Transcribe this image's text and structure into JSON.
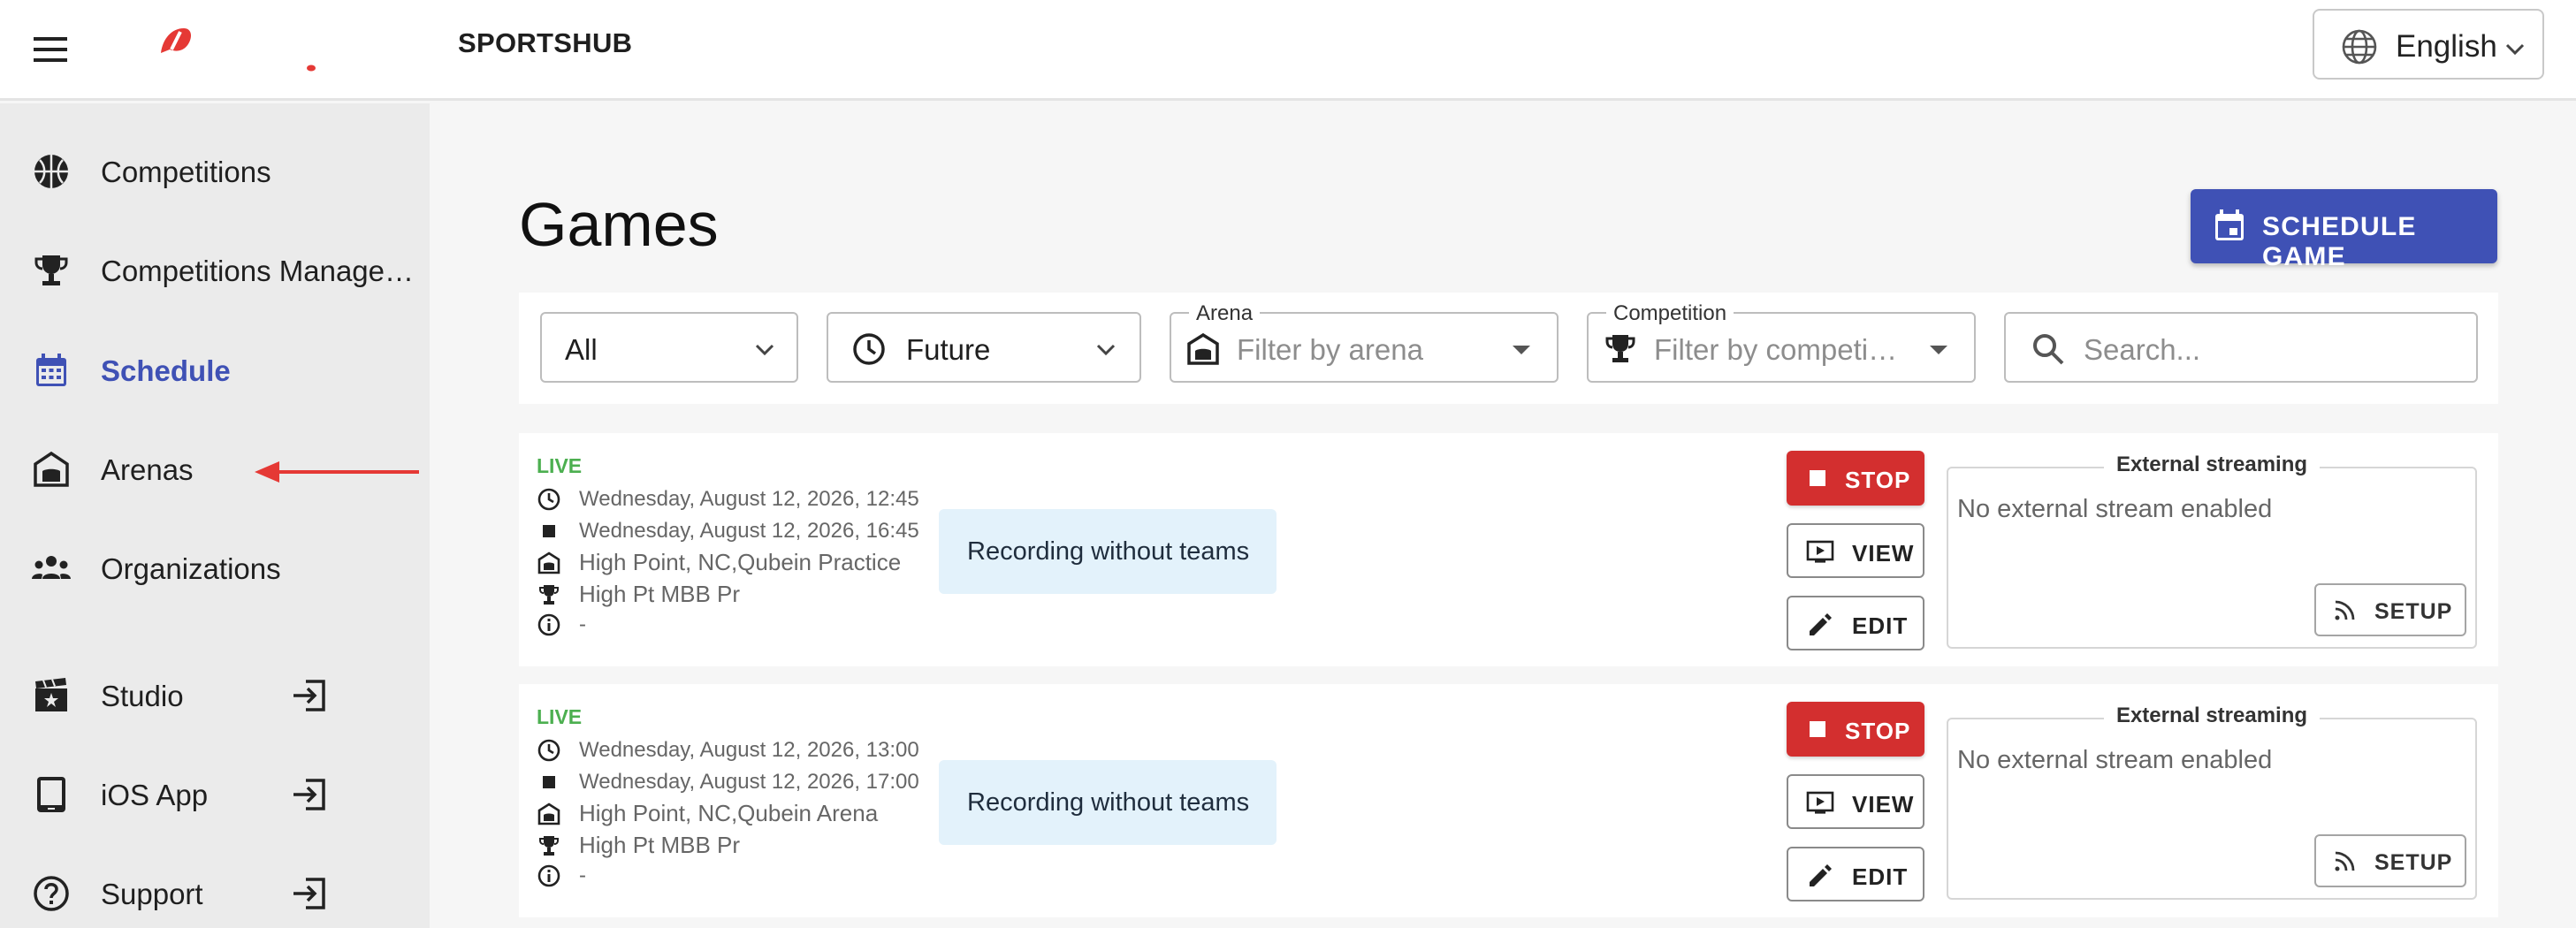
{
  "header": {
    "app_title": "SPORTSHUB",
    "language": "English"
  },
  "sidebar": {
    "items": [
      {
        "label": "Competitions",
        "icon": "basketball-icon"
      },
      {
        "label": "Competitions Management",
        "icon": "trophy-icon"
      },
      {
        "label": "Schedule",
        "icon": "calendar-icon",
        "active": true
      },
      {
        "label": "Arenas",
        "icon": "arena-icon"
      },
      {
        "label": "Organizations",
        "icon": "groups-icon"
      },
      {
        "label": "Studio",
        "icon": "studio-icon",
        "external": true
      },
      {
        "label": "iOS App",
        "icon": "tablet-icon",
        "external": true
      },
      {
        "label": "Support",
        "icon": "help-icon",
        "external": true
      }
    ]
  },
  "main": {
    "title": "Games",
    "schedule_button": "SCHEDULE GAME",
    "filters": {
      "type_value": "All",
      "time_value": "Future",
      "arena_label": "Arena",
      "arena_placeholder": "Filter by arena",
      "competition_label": "Competition",
      "competition_placeholder": "Filter by competition",
      "search_placeholder": "Search..."
    },
    "games": [
      {
        "status": "LIVE",
        "start": "Wednesday, August 12, 2026, 12:45",
        "end": "Wednesday, August 12, 2026, 16:45",
        "arena": "High Point, NC,Qubein Practice",
        "competition": "High Pt MBB Pr",
        "info": "-",
        "recording": "Recording without teams",
        "stop": "STOP",
        "view": "VIEW",
        "edit": "EDIT",
        "streaming_title": "External streaming",
        "streaming_empty": "No external stream enabled",
        "setup": "SETUP"
      },
      {
        "status": "LIVE",
        "start": "Wednesday, August 12, 2026, 13:00",
        "end": "Wednesday, August 12, 2026, 17:00",
        "arena": "High Point, NC,Qubein Arena",
        "competition": "High Pt MBB Pr",
        "info": "-",
        "recording": "Recording without teams",
        "stop": "STOP",
        "view": "VIEW",
        "edit": "EDIT",
        "streaming_title": "External streaming",
        "streaming_empty": "No external stream enabled",
        "setup": "SETUP"
      }
    ]
  },
  "colors": {
    "primary": "#3f51b5",
    "live": "#4caf50",
    "stop": "#d32f2f",
    "chip": "#e3f2fb",
    "annotation_arrow": "#e53935"
  }
}
